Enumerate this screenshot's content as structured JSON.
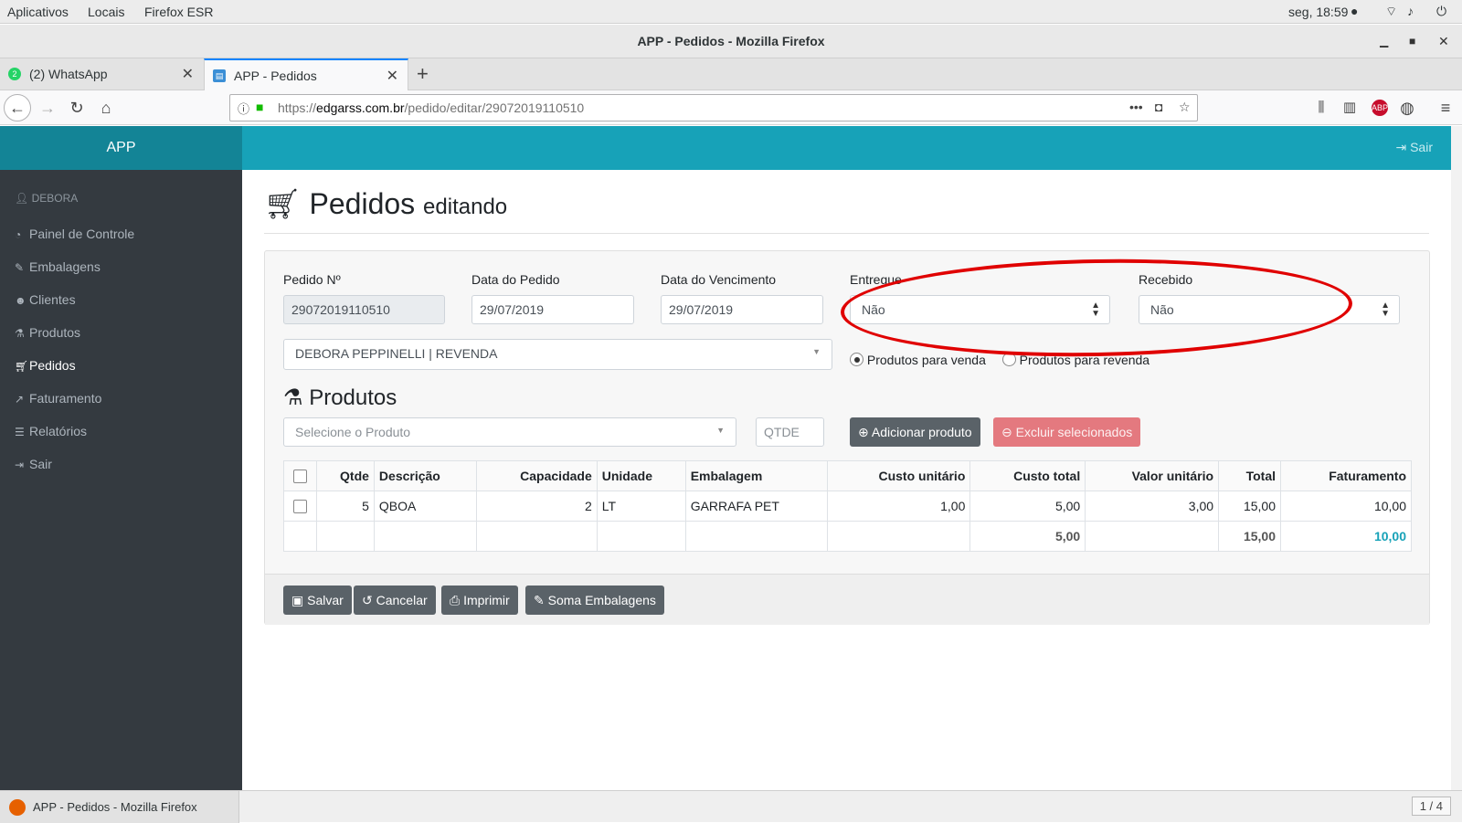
{
  "gnome": {
    "menu": [
      "Aplicativos",
      "Locais",
      "Firefox ESR"
    ],
    "clock": "seg, 18:59"
  },
  "window": {
    "title": "APP - Pedidos - Mozilla Firefox"
  },
  "tabs": [
    {
      "label": "(2) WhatsApp",
      "badge": "2",
      "active": false
    },
    {
      "label": "APP - Pedidos",
      "active": true
    }
  ],
  "url": {
    "prefix": "https://",
    "domain": "edgarss.com.br",
    "path": "/pedido/editar/29072019110510"
  },
  "app": {
    "brand": "APP",
    "top_logout": "Sair",
    "user": "DEBORA",
    "sidebar": [
      {
        "label": "Painel de Controle",
        "icon": "dashboard-icon"
      },
      {
        "label": "Embalagens",
        "icon": "brush-icon"
      },
      {
        "label": "Clientes",
        "icon": "users-icon"
      },
      {
        "label": "Produtos",
        "icon": "flask-icon"
      },
      {
        "label": "Pedidos",
        "icon": "cart-icon",
        "active": true
      },
      {
        "label": "Faturamento",
        "icon": "chart-icon"
      },
      {
        "label": "Relatórios",
        "icon": "list-icon"
      },
      {
        "label": "Sair",
        "icon": "logout-icon"
      }
    ]
  },
  "page": {
    "title": "Pedidos",
    "subtitle": "editando"
  },
  "form": {
    "pedido_label": "Pedido Nº",
    "pedido_value": "29072019110510",
    "data_pedido_label": "Data do Pedido",
    "data_pedido_value": "29/07/2019",
    "data_venc_label": "Data do Vencimento",
    "data_venc_value": "29/07/2019",
    "entregue_label": "Entregue",
    "entregue_value": "Não",
    "recebido_label": "Recebido",
    "recebido_value": "Não",
    "cliente_value": "DEBORA PEPPINELLI | REVENDA",
    "radio_venda": "Produtos para venda",
    "radio_revenda": "Produtos para revenda"
  },
  "produtos": {
    "title": "Produtos",
    "select_placeholder": "Selecione o Produto",
    "qtde_placeholder": "QTDE",
    "add_button": "Adicionar produto",
    "delete_button": "Excluir selecionados",
    "columns": [
      "Qtde",
      "Descrição",
      "Capacidade",
      "Unidade",
      "Embalagem",
      "Custo unitário",
      "Custo total",
      "Valor unitário",
      "Total",
      "Faturamento"
    ],
    "rows": [
      {
        "qtde": "5",
        "descricao": "QBOA",
        "capacidade": "2",
        "unidade": "LT",
        "embalagem": "GARRAFA PET",
        "custo_unit": "1,00",
        "custo_total": "5,00",
        "valor_unit": "3,00",
        "total": "15,00",
        "faturamento": "10,00"
      }
    ],
    "totals": {
      "custo_total": "5,00",
      "total": "15,00",
      "faturamento": "10,00"
    }
  },
  "footer_buttons": {
    "save": "Salvar",
    "cancel": "Cancelar",
    "print": "Imprimir",
    "sum": "Soma Embalagens"
  },
  "taskbar": {
    "item": "APP - Pedidos - Mozilla Firefox",
    "workspace": "1 / 4"
  },
  "colors": {
    "accent": "#17a2b8",
    "sidebar": "#343a40",
    "annotation": "#e00000"
  }
}
